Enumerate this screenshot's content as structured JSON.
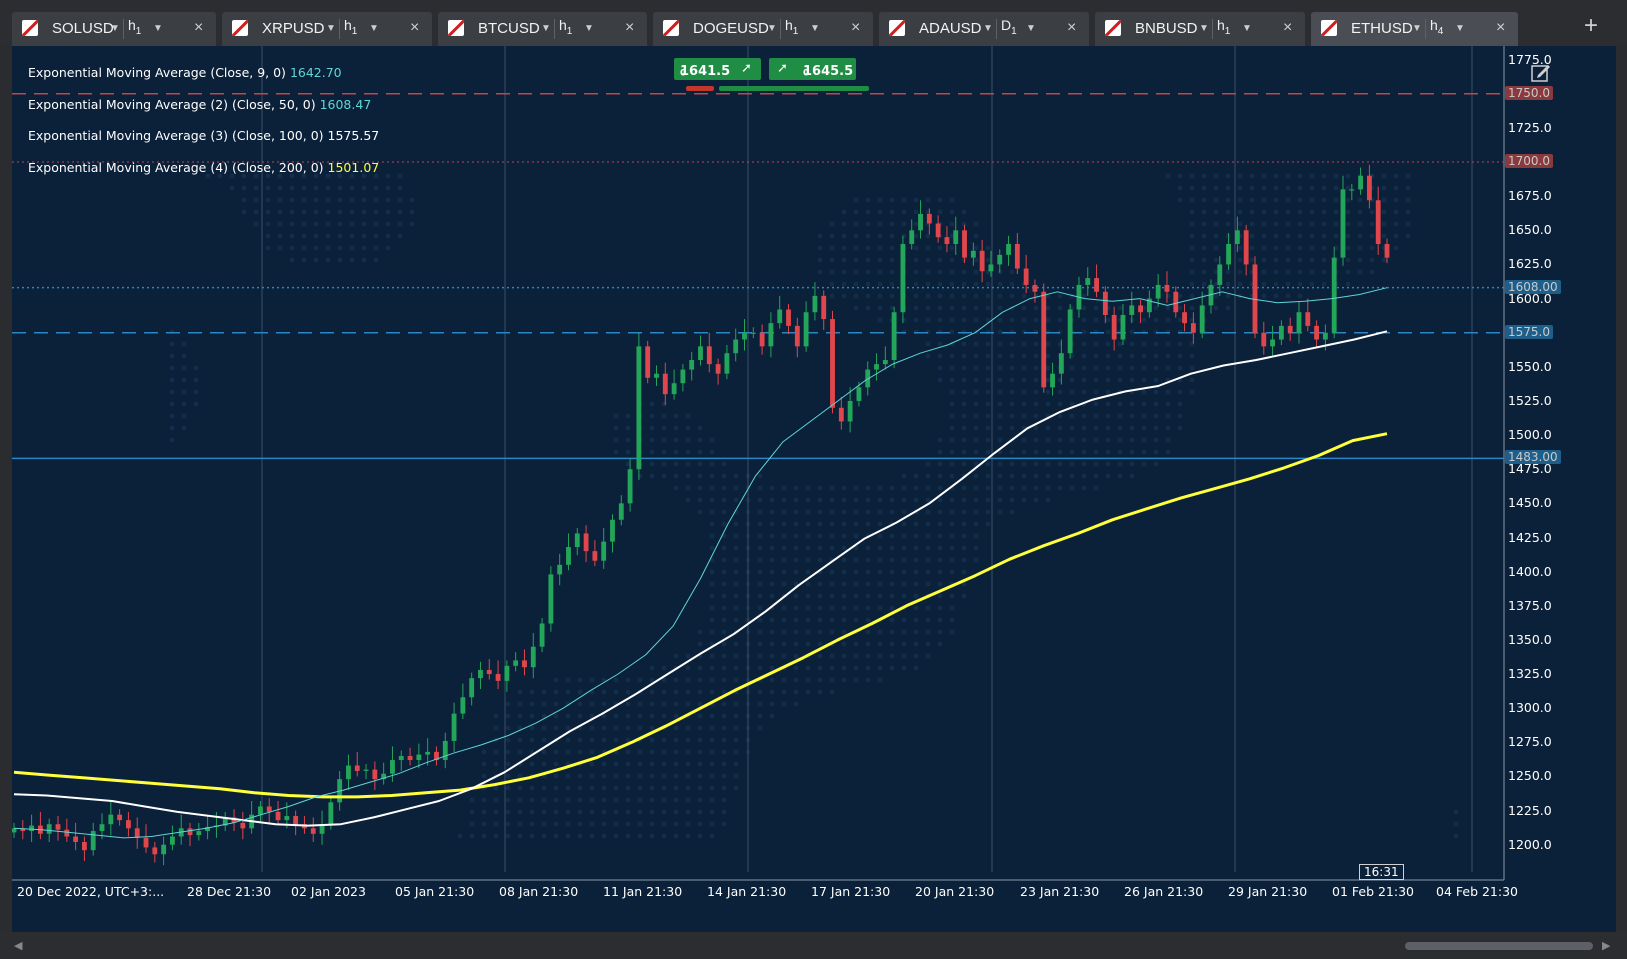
{
  "tabs": [
    {
      "symbol": "SOLUSD",
      "tf": "h",
      "tf_n": "1"
    },
    {
      "symbol": "XRPUSD",
      "tf": "h",
      "tf_n": "1"
    },
    {
      "symbol": "BTCUSD",
      "tf": "h",
      "tf_n": "1"
    },
    {
      "symbol": "DOGEUSD",
      "tf": "h",
      "tf_n": "1"
    },
    {
      "symbol": "ADAUSD",
      "tf": "D",
      "tf_n": "1"
    },
    {
      "symbol": "BNBUSD",
      "tf": "h",
      "tf_n": "1"
    },
    {
      "symbol": "ETHUSD",
      "tf": "h",
      "tf_n": "4",
      "active": true
    }
  ],
  "icons": {
    "close": "×",
    "add": "+",
    "dropdown": "▼",
    "buy_arrow": "➚",
    "sell_arrow": "➚"
  },
  "legend": [
    {
      "label": "Exponential Moving Average (Close, 9, 0)",
      "value": "1642.70",
      "color": "#5fd6d6"
    },
    {
      "label": "Exponential Moving Average (2) (Close, 50, 0)",
      "value": "1608.47",
      "color": "#5fd6d6"
    },
    {
      "label": "Exponential Moving Average (3) (Close, 100, 0)",
      "value": "1575.57",
      "color": "#ffffff"
    },
    {
      "label": "Exponential Moving Average (4) (Close, 200, 0)",
      "value": "1501.07",
      "color": "#ffff3c"
    }
  ],
  "trade": {
    "sell_price": "1641.5",
    "sell_sup": "0",
    "buy_price": "1645.5",
    "buy_sup": "0"
  },
  "y_axis_labels": [
    "1775.0",
    "1725.0",
    "1675.0",
    "1650.0",
    "1625.0",
    "1600.0",
    "1550.0",
    "1525.0",
    "1500.0",
    "1475.0",
    "1450.0",
    "1425.0",
    "1400.0",
    "1375.0",
    "1350.0",
    "1325.0",
    "1300.0",
    "1275.0",
    "1250.0",
    "1225.0",
    "1200.0"
  ],
  "price_tags": [
    {
      "text": "1750.0",
      "style": "red-dashed"
    },
    {
      "text": "1700.0",
      "style": "red-dotted"
    },
    {
      "text": "1608.00",
      "style": "blue-dotted"
    },
    {
      "text": "1575.0",
      "style": "blue-dashed"
    },
    {
      "text": "1483.00",
      "style": "blue-solid"
    }
  ],
  "x_axis_labels": [
    "20 Dec 2022, UTC+3:...",
    "28 Dec 21:30",
    "02 Jan 2023",
    "05 Jan 21:30",
    "08 Jan 21:30",
    "11 Jan 21:30",
    "14 Jan 21:30",
    "17 Jan 21:30",
    "20 Jan 21:30",
    "23 Jan 21:30",
    "26 Jan 21:30",
    "29 Jan 21:30",
    "01 Feb 21:30",
    "04 Feb 21:30"
  ],
  "current_time": "16:31",
  "colors": {
    "bull": "#23a55a",
    "bear": "#e0474c",
    "ema9": "#5fd6d6",
    "ema50": "#ffffff",
    "ema200": "#ffff3c",
    "background": "#0b2039"
  },
  "chart_data": {
    "type": "candlestick",
    "symbol": "ETHUSD",
    "timeframe": "h4",
    "ylim": [
      1180,
      1785
    ],
    "x_range": [
      "20 Dec 2022",
      "05 Feb 2023"
    ],
    "candles_close": [
      1212,
      1210,
      1214,
      1208,
      1215,
      1211,
      1206,
      1202,
      1196,
      1210,
      1215,
      1222,
      1218,
      1212,
      1205,
      1198,
      1193,
      1200,
      1206,
      1212,
      1207,
      1210,
      1213,
      1214,
      1220,
      1216,
      1212,
      1222,
      1228,
      1224,
      1218,
      1221,
      1215,
      1212,
      1208,
      1215,
      1231,
      1248,
      1258,
      1254,
      1255,
      1248,
      1252,
      1262,
      1265,
      1262,
      1266,
      1268,
      1262,
      1276,
      1296,
      1308,
      1322,
      1328,
      1325,
      1320,
      1331,
      1335,
      1330,
      1345,
      1362,
      1398,
      1405,
      1418,
      1428,
      1415,
      1408,
      1422,
      1438,
      1450,
      1475,
      1565,
      1542,
      1545,
      1530,
      1538,
      1548,
      1555,
      1565,
      1552,
      1545,
      1560,
      1570,
      1575,
      1575,
      1565,
      1582,
      1592,
      1580,
      1565,
      1590,
      1602,
      1585,
      1520,
      1510,
      1525,
      1535,
      1548,
      1552,
      1555,
      1590,
      1640,
      1650,
      1662,
      1655,
      1645,
      1640,
      1650,
      1630,
      1635,
      1620,
      1625,
      1632,
      1640,
      1622,
      1610,
      1605,
      1535,
      1545,
      1560,
      1592,
      1610,
      1615,
      1605,
      1588,
      1570,
      1588,
      1595,
      1590,
      1600,
      1610,
      1605,
      1590,
      1582,
      1575,
      1595,
      1610,
      1625,
      1640,
      1650,
      1625,
      1575,
      1565,
      1570,
      1580,
      1575,
      1590,
      1580,
      1570,
      1575,
      1630,
      1680,
      1680,
      1690,
      1672,
      1640,
      1630
    ],
    "ema9": [
      1212,
      1211,
      1209,
      1207,
      1205,
      1206,
      1209,
      1212,
      1216,
      1222,
      1228,
      1235,
      1240,
      1246,
      1252,
      1260,
      1267,
      1273,
      1280,
      1289,
      1300,
      1313,
      1325,
      1339,
      1360,
      1395,
      1435,
      1470,
      1495,
      1510,
      1525,
      1540,
      1552,
      1560,
      1566,
      1575,
      1590,
      1600,
      1605,
      1600,
      1598,
      1600,
      1595,
      1600,
      1605,
      1600,
      1597,
      1598,
      1600,
      1603,
      1608
    ],
    "ema50": [
      1237,
      1236,
      1234,
      1232,
      1228,
      1224,
      1221,
      1218,
      1215,
      1214,
      1215,
      1220,
      1226,
      1232,
      1241,
      1253,
      1268,
      1283,
      1296,
      1310,
      1325,
      1340,
      1354,
      1371,
      1390,
      1407,
      1424,
      1436,
      1450,
      1468,
      1487,
      1505,
      1517,
      1526,
      1532,
      1536,
      1545,
      1551,
      1555,
      1560,
      1565,
      1570,
      1576
    ],
    "ema200": [
      1253,
      1251,
      1249,
      1247,
      1245,
      1243,
      1241,
      1238,
      1236,
      1235,
      1235,
      1236,
      1238,
      1240,
      1244,
      1249,
      1256,
      1264,
      1275,
      1287,
      1300,
      1313,
      1325,
      1337,
      1350,
      1362,
      1375,
      1386,
      1397,
      1409,
      1419,
      1428,
      1438,
      1446,
      1454,
      1461,
      1468,
      1476,
      1485,
      1496,
      1501
    ]
  }
}
